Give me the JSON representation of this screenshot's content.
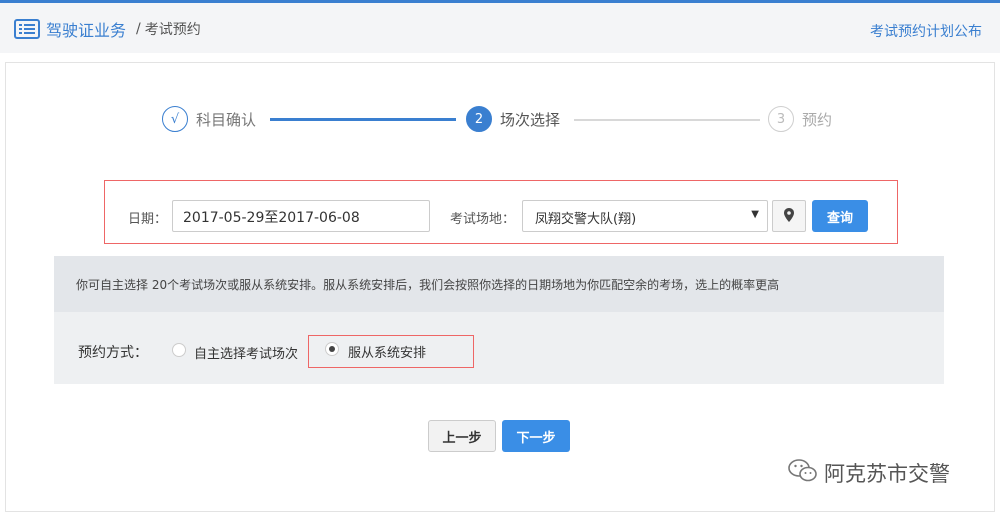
{
  "header": {
    "title": "驾驶证业务",
    "separator": "/",
    "breadcrumb_current": "考试预约",
    "right_link": "考试预约计划公布"
  },
  "steps": [
    {
      "number": "√",
      "label": "科目确认",
      "state": "done"
    },
    {
      "number": "2",
      "label": "场次选择",
      "state": "active"
    },
    {
      "number": "3",
      "label": "预约",
      "state": "todo"
    }
  ],
  "search": {
    "date_label": "日期：",
    "date_value": "2017-05-29至2017-06-08",
    "venue_label": "考试场地：",
    "venue_value": "凤翔交警大队(翔)",
    "query_button": "查询"
  },
  "info": {
    "text": "你可自主选择 20个考试场次或服从系统安排。服从系统安排后，我们会按照你选择的日期场地为你匹配空余的考场，选上的概率更高"
  },
  "mode": {
    "label": "预约方式：",
    "options": [
      {
        "label": "自主选择考试场次",
        "selected": false
      },
      {
        "label": "服从系统安排",
        "selected": true
      }
    ]
  },
  "nav": {
    "prev": "上一步",
    "next": "下一步"
  },
  "watermark": {
    "text": "阿克苏市交警",
    "icon": "wechat-icon"
  },
  "colors": {
    "accent": "#3a7fd0",
    "highlight_border": "#ee6666",
    "info_bg": "#e3e6ea"
  }
}
